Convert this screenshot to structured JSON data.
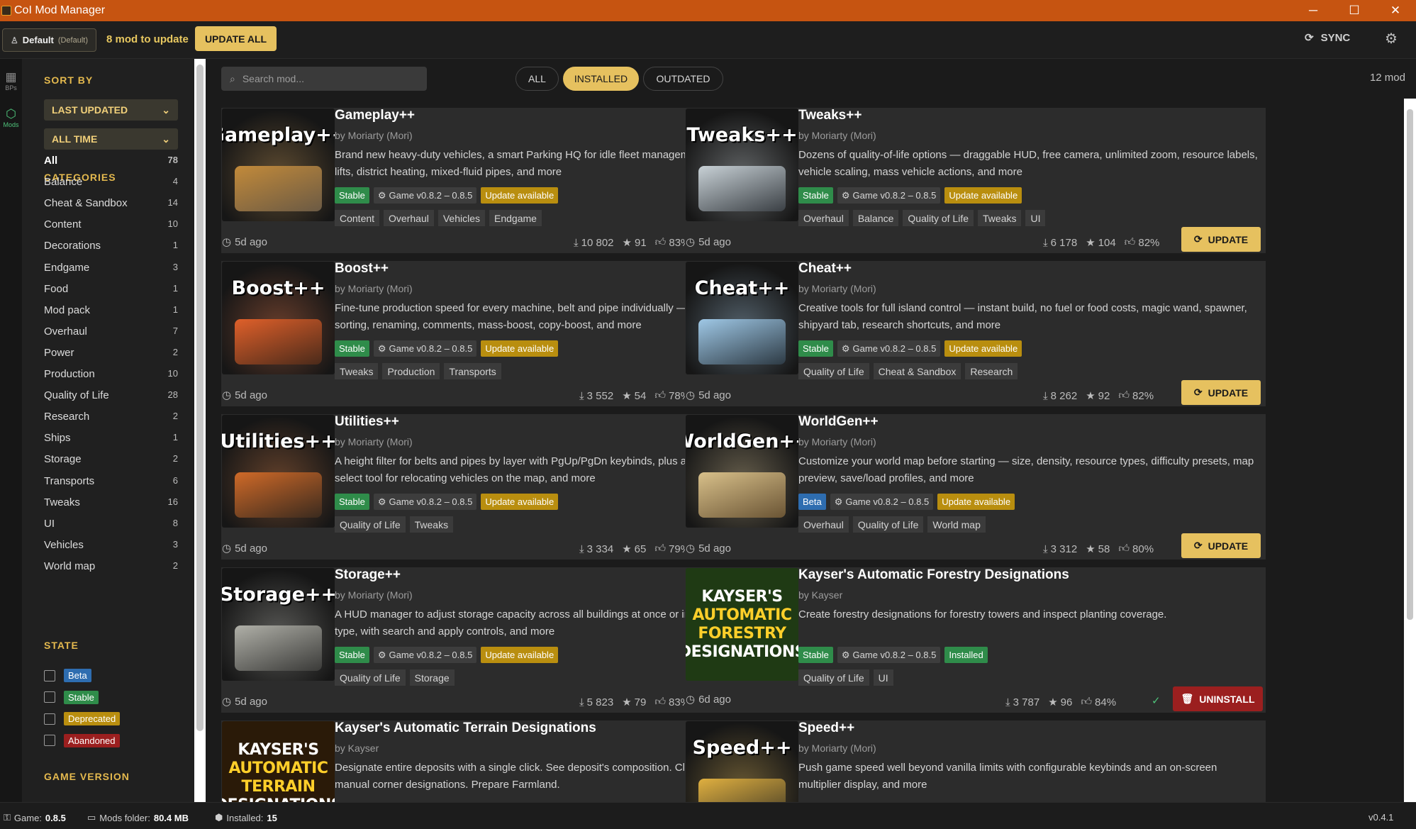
{
  "app": {
    "title": "CoI Mod Manager"
  },
  "topbar": {
    "profile_name": "Default",
    "profile_tag": "(Default)",
    "update_count": "8 mod to update",
    "update_all_label": "UPDATE ALL",
    "sync_label": "SYNC"
  },
  "rail": {
    "blueprints_label": "BPs",
    "mods_label": "Mods"
  },
  "sidebar": {
    "sort_by_heading": "SORT BY",
    "sort_value": "LAST UPDATED",
    "time_value": "ALL TIME",
    "categories_heading": "CATEGORIES",
    "categories": [
      {
        "label": "All",
        "count": "78"
      },
      {
        "label": "Balance",
        "count": "4"
      },
      {
        "label": "Cheat & Sandbox",
        "count": "14"
      },
      {
        "label": "Content",
        "count": "10"
      },
      {
        "label": "Decorations",
        "count": "1"
      },
      {
        "label": "Endgame",
        "count": "3"
      },
      {
        "label": "Food",
        "count": "1"
      },
      {
        "label": "Mod pack",
        "count": "1"
      },
      {
        "label": "Overhaul",
        "count": "7"
      },
      {
        "label": "Power",
        "count": "2"
      },
      {
        "label": "Production",
        "count": "10"
      },
      {
        "label": "Quality of Life",
        "count": "28"
      },
      {
        "label": "Research",
        "count": "2"
      },
      {
        "label": "Ships",
        "count": "1"
      },
      {
        "label": "Storage",
        "count": "2"
      },
      {
        "label": "Transports",
        "count": "6"
      },
      {
        "label": "Tweaks",
        "count": "16"
      },
      {
        "label": "UI",
        "count": "8"
      },
      {
        "label": "Vehicles",
        "count": "3"
      },
      {
        "label": "World map",
        "count": "2"
      }
    ],
    "state_heading": "STATE",
    "states": [
      {
        "label": "Beta",
        "color": "#2e6db0"
      },
      {
        "label": "Stable",
        "color": "#2f8c4a"
      },
      {
        "label": "Deprecated",
        "color": "#b98e0f"
      },
      {
        "label": "Abandoned",
        "color": "#9b1f1f"
      }
    ],
    "game_version_heading": "GAME VERSION"
  },
  "toolbar": {
    "search_placeholder": "Search mod...",
    "filter_all": "ALL",
    "filter_installed": "INSTALLED",
    "filter_outdated": "OUTDATED",
    "mod_count": "12 mod"
  },
  "mods": [
    {
      "name": "Gameplay++",
      "author": "by Moriarty (Mori)",
      "desc": "Brand new heavy-duty vehicles, a smart Parking HQ for idle fleet management, molten storage & lifts, district heating, mixed-fluid pipes, and more",
      "state": "Stable",
      "game": "Game v0.8.2 – 0.8.5",
      "status": "Update available",
      "tags": [
        "Content",
        "Overhaul",
        "Vehicles",
        "Endgame"
      ],
      "ago": "5d ago",
      "downloads": "10 802",
      "stars": "91",
      "likes": "83%",
      "action": "UPDATE",
      "logo": "Gameplay++"
    },
    {
      "name": "Tweaks++",
      "author": "by Moriarty (Mori)",
      "desc": "Dozens of quality-of-life options — draggable HUD, free camera, unlimited zoom, resource labels, vehicle scaling, mass vehicle actions, and more",
      "state": "Stable",
      "game": "Game v0.8.2 – 0.8.5",
      "status": "Update available",
      "tags": [
        "Overhaul",
        "Balance",
        "Quality of Life",
        "Tweaks",
        "UI"
      ],
      "ago": "5d ago",
      "downloads": "6 178",
      "stars": "104",
      "likes": "82%",
      "action": "UPDATE",
      "logo": "Tweaks++"
    },
    {
      "name": "Boost++",
      "author": "by Moriarty (Mori)",
      "desc": "Fine-tune production speed for every machine, belt and pipe individually — with a manager for sorting, renaming, comments, mass-boost, copy-boost, and more",
      "state": "Stable",
      "game": "Game v0.8.2 – 0.8.5",
      "status": "Update available",
      "tags": [
        "Tweaks",
        "Production",
        "Transports"
      ],
      "ago": "5d ago",
      "downloads": "3 552",
      "stars": "54",
      "likes": "78%",
      "action": "UPDATE",
      "logo": "Boost++"
    },
    {
      "name": "Cheat++",
      "author": "by Moriarty (Mori)",
      "desc": "Creative tools for full island control — instant build, no fuel or food costs, magic wand, spawner, shipyard tab, research shortcuts, and more",
      "state": "Stable",
      "game": "Game v0.8.2 – 0.8.5",
      "status": "Update available",
      "tags": [
        "Quality of Life",
        "Cheat & Sandbox",
        "Research"
      ],
      "ago": "5d ago",
      "downloads": "8 262",
      "stars": "92",
      "likes": "82%",
      "action": "UPDATE",
      "logo": "Cheat++"
    },
    {
      "name": "Utilities++",
      "author": "by Moriarty (Mori)",
      "desc": "A height filter for belts and pipes by layer with PgUp/PgDn keybinds, plus a Vehicle Mover drag-select tool for relocating vehicles on the map, and more",
      "state": "Stable",
      "game": "Game v0.8.2 – 0.8.5",
      "status": "Update available",
      "tags": [
        "Quality of Life",
        "Tweaks"
      ],
      "ago": "5d ago",
      "downloads": "3 334",
      "stars": "65",
      "likes": "79%",
      "action": "UPDATE",
      "logo": "Utilities++"
    },
    {
      "name": "WorldGen++",
      "author": "by Moriarty (Mori)",
      "desc": "Customize your world map before starting — size, density, resource types, difficulty presets, map preview, save/load profiles, and more",
      "state": "Beta",
      "game": "Game v0.8.2 – 0.8.5",
      "status": "Update available",
      "tags": [
        "Overhaul",
        "Quality of Life",
        "World map"
      ],
      "ago": "5d ago",
      "downloads": "3 312",
      "stars": "58",
      "likes": "80%",
      "action": "UPDATE",
      "logo": "WorldGen++"
    },
    {
      "name": "Storage++",
      "author": "by Moriarty (Mori)",
      "desc": "A HUD manager to adjust storage capacity across all buildings at once or individually, filtered by type, with search and apply controls, and more",
      "state": "Stable",
      "game": "Game v0.8.2 – 0.8.5",
      "status": "Update available",
      "tags": [
        "Quality of Life",
        "Storage"
      ],
      "ago": "5d ago",
      "downloads": "5 823",
      "stars": "79",
      "likes": "83%",
      "action": "UPDATE",
      "logo": "Storage++"
    },
    {
      "name": "Kayser's Automatic Forestry Designations",
      "author": "by Kayser",
      "desc": "Create forestry designations for forestry towers and inspect planting coverage.",
      "state": "Stable",
      "game": "Game v0.8.2 – 0.8.5",
      "status": "Installed",
      "tags": [
        "Quality of Life",
        "UI"
      ],
      "ago": "6d ago",
      "downloads": "3 787",
      "stars": "96",
      "likes": "84%",
      "action": "UNINSTALL",
      "logo_lines": [
        "KAYSER'S",
        "AUTOMATIC",
        "FORESTRY",
        "DESIGNATIONS"
      ]
    },
    {
      "name": "Kayser's Automatic Terrain Designations",
      "author": "by Kayser",
      "desc": "Designate entire deposits with a single click. See deposit's composition. Clear debris. Create manual corner designations. Prepare Farmland.",
      "logo_lines": [
        "KAYSER'S",
        "AUTOMATIC",
        "TERRAIN",
        "DESIGNATIONS"
      ]
    },
    {
      "name": "Speed++",
      "author": "by Moriarty (Mori)",
      "desc": "Push game speed well beyond vanilla limits with configurable keybinds and an on-screen multiplier display, and more",
      "logo": "Speed++"
    }
  ],
  "statusbar": {
    "game_label": "Game:",
    "game_value": "0.8.5",
    "folder_label": "Mods folder:",
    "folder_value": "80.4 MB",
    "installed_label": "Installed:",
    "installed_value": "15",
    "app_version": "v0.4.1"
  }
}
